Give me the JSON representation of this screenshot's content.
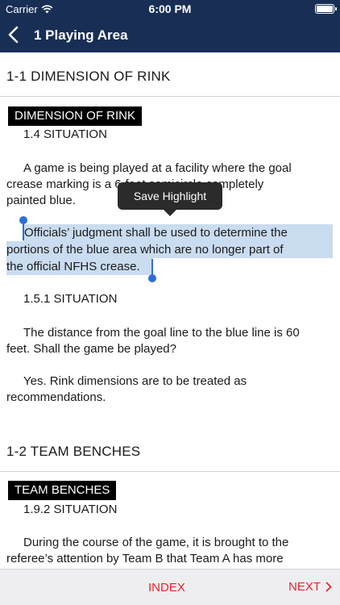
{
  "status_bar": {
    "carrier": "Carrier",
    "time": "6:00 PM"
  },
  "nav": {
    "title": "1 Playing Area"
  },
  "sections": [
    {
      "title": "1-1 DIMENSION OF RINK",
      "label": "DIMENSION OF RINK",
      "situations": [
        {
          "number": "1.4 SITUATION",
          "question_lines": [
            "A game is being played at a facility where the goal",
            "crease marking is a 6-foot semicircle completely",
            "painted blue."
          ],
          "answer_lines": [
            "Officials’ judgment shall be used to determine the",
            "portions of the blue area which are no longer part of",
            "the official NFHS crease."
          ]
        },
        {
          "number": "1.5.1 SITUATION",
          "question_lines": [
            "The distance from the goal line to the blue line is 60",
            "feet. Shall the game be played?"
          ],
          "answer_lines": [
            "Yes. Rink dimensions are to be treated as",
            "recommendations."
          ]
        }
      ]
    },
    {
      "title": "1-2 TEAM BENCHES",
      "label": "TEAM BENCHES",
      "situations": [
        {
          "number": "1.9.2 SITUATION",
          "question_lines": [
            "During the course of the game, it is brought to the",
            "referee’s attention by Team B that Team A has more"
          ]
        }
      ]
    }
  ],
  "tooltip": {
    "label": "Save Highlight"
  },
  "bottom_bar": {
    "index_label": "INDEX",
    "next_label": "NEXT"
  },
  "colors": {
    "nav_bg": "#182e55",
    "highlight": "#c9dcf0",
    "accent": "#e0282f",
    "handle": "#2e6fd6"
  },
  "icons": {
    "wifi": "wifi-icon",
    "battery": "battery-icon",
    "back": "chevron-left-icon",
    "next": "chevron-right-icon"
  }
}
